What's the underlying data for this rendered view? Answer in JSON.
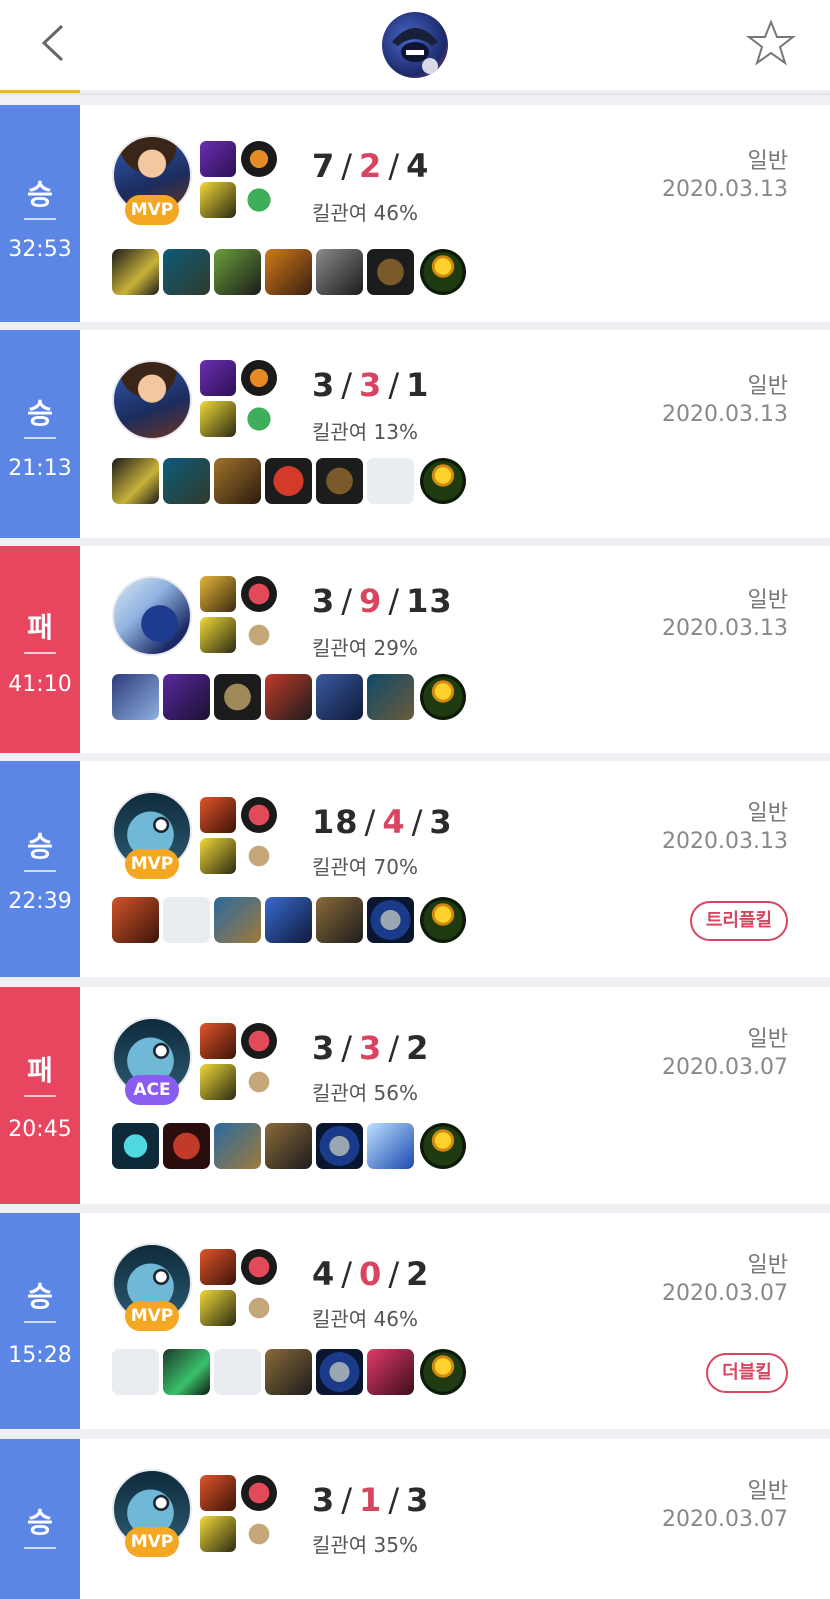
{
  "header": {
    "back_icon": "chevron-left-icon",
    "favorite_icon": "star-outline-icon",
    "accent": "#e9b23a"
  },
  "colors": {
    "win": "#5b86e5",
    "loss": "#e8455f",
    "deaths": "#d84560",
    "mvp": "#f3a722",
    "ace": "#8b5cf0"
  },
  "matches": [
    {
      "result": "승",
      "duration": "32:53",
      "champion": "garen",
      "badge": "MVP",
      "kills": "7",
      "deaths": "2",
      "assists": "4",
      "kill_participation": "킬관여 46%",
      "mode": "일반",
      "date": "2020.03.13",
      "multikill": ""
    },
    {
      "result": "승",
      "duration": "21:13",
      "champion": "garen",
      "badge": "",
      "kills": "3",
      "deaths": "3",
      "assists": "1",
      "kill_participation": "킬관여 13%",
      "mode": "일반",
      "date": "2020.03.13",
      "multikill": ""
    },
    {
      "result": "패",
      "duration": "41:10",
      "champion": "kassadin",
      "badge": "",
      "kills": "3",
      "deaths": "9",
      "assists": "13",
      "kill_participation": "킬관여 29%",
      "mode": "일반",
      "date": "2020.03.13",
      "multikill": ""
    },
    {
      "result": "승",
      "duration": "22:39",
      "champion": "fizz",
      "badge": "MVP",
      "kills": "18",
      "deaths": "4",
      "assists": "3",
      "kill_participation": "킬관여 70%",
      "mode": "일반",
      "date": "2020.03.13",
      "multikill": "트리플킬"
    },
    {
      "result": "패",
      "duration": "20:45",
      "champion": "fizz",
      "badge": "ACE",
      "kills": "3",
      "deaths": "3",
      "assists": "2",
      "kill_participation": "킬관여 56%",
      "mode": "일반",
      "date": "2020.03.07",
      "multikill": ""
    },
    {
      "result": "승",
      "duration": "15:28",
      "champion": "fizz",
      "badge": "MVP",
      "kills": "4",
      "deaths": "0",
      "assists": "2",
      "kill_participation": "킬관여 46%",
      "mode": "일반",
      "date": "2020.03.07",
      "multikill": "더블킬"
    },
    {
      "result": "승",
      "duration": "",
      "champion": "fizz",
      "badge": "MVP",
      "kills": "3",
      "deaths": "1",
      "assists": "3",
      "kill_participation": "킬관여 35%",
      "mode": "일반",
      "date": "2020.03.07",
      "multikill": ""
    }
  ]
}
